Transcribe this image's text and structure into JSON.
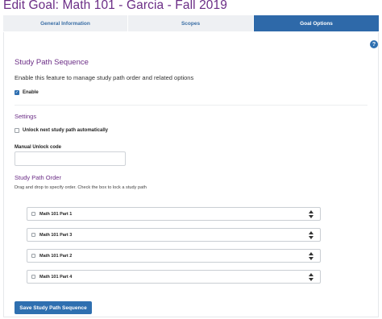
{
  "page": {
    "title": "Edit Goal: Math 101 - Garcia - Fall 2019"
  },
  "tabs": [
    {
      "label": "General Information",
      "active": false
    },
    {
      "label": "Scopes",
      "active": false
    },
    {
      "label": "Goal Options",
      "active": true
    }
  ],
  "help": {
    "glyph": "?"
  },
  "study_path": {
    "title": "Study Path Sequence",
    "description": "Enable this feature to manage study path order and related options",
    "enable_label": "Enable",
    "enable_checked": true
  },
  "settings": {
    "title": "Settings",
    "unlock_auto_label": "Unlock next study path automatically",
    "unlock_auto_checked": false,
    "manual_unlock_label": "Manual Unlock code",
    "manual_unlock_value": ""
  },
  "order": {
    "title": "Study Path Order",
    "instructions": "Drag and drop to specify order. Check the box to lock a study path",
    "items": [
      {
        "label": "Math 101 Part 1",
        "locked": false
      },
      {
        "label": "Math 101 Part 3",
        "locked": false
      },
      {
        "label": "Math 101 Part 2",
        "locked": false
      },
      {
        "label": "Math 101 Part 4",
        "locked": false
      }
    ]
  },
  "actions": {
    "save_label": "Save Study Path Sequence"
  },
  "colors": {
    "accent": "#2e6fb0",
    "heading": "#6b2d86",
    "tab_inactive": "#eef0f3"
  },
  "icons": {
    "sort": "sort-updown-icon",
    "help": "help-icon",
    "check": "checkmark-icon"
  }
}
